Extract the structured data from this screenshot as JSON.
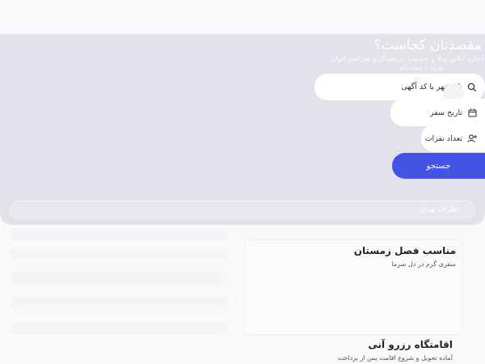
{
  "hero": {
    "title": "مقصدتان کجاست؟",
    "subtitle": "اجاره آنلاین ویلا و سوئیت در شمال و سراسر ایران",
    "login": "ورود / ثبت نام"
  },
  "search": {
    "placeholder": "نام شهر یا کد آگهی",
    "date_label": "تاریخ سفر",
    "guests_label": "تعداد نفرات",
    "button": "جستجو"
  },
  "area_chip": "اطراف تهران",
  "sections": [
    {
      "title": "مناسب فصل زمستان",
      "subtitle": "سفری گرم در دل سرما"
    },
    {
      "title": "اقامتگاه رزرو آنی",
      "subtitle": "آماده تحویل و شروع اقامت پس از پرداخت"
    }
  ],
  "colors": {
    "accent": "#4353e3",
    "hero_bg": "#e2e3ea"
  }
}
